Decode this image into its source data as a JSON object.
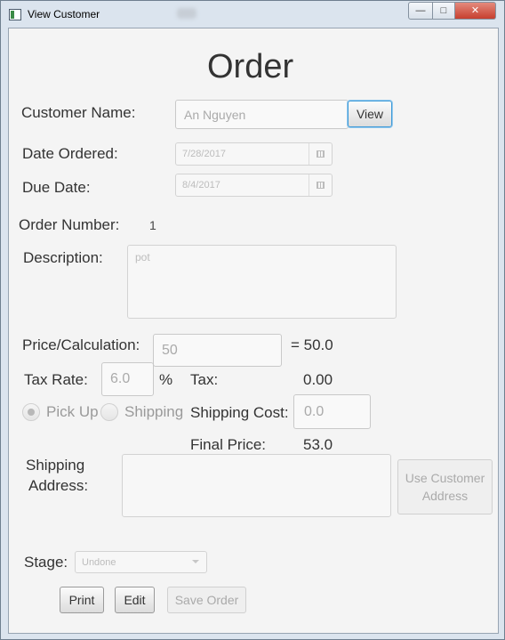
{
  "window": {
    "title": "View Customer"
  },
  "form": {
    "heading": "Order",
    "customer_name_label": "Customer Name:",
    "customer_name_value": "An Nguyen",
    "view_button": "View",
    "date_ordered_label": "Date Ordered:",
    "date_ordered_value": "7/28/2017",
    "due_date_label": "Due Date:",
    "due_date_value": "8/4/2017",
    "order_number_label": "Order Number:",
    "order_number_value": "1",
    "description_label": "Description:",
    "description_value": "pot",
    "price_label": "Price/Calculation:",
    "price_value": "50",
    "price_result": "= 50.0",
    "tax_rate_label": "Tax Rate:",
    "tax_rate_value": "6.0",
    "percent_sign": "%",
    "tax_label": "Tax:",
    "tax_value": "0.00",
    "pickup_label": "Pick Up",
    "shipping_label": "Shipping",
    "delivery_selected": "Pick Up",
    "shipping_cost_label": "Shipping Cost:",
    "shipping_cost_value": "0.0",
    "final_price_label": "Final Price:",
    "final_price_value": "53.0",
    "shipping_address_label_line1": "Shipping",
    "shipping_address_label_line2": "Address:",
    "shipping_address_value": "",
    "use_customer_address_line1": "Use Customer",
    "use_customer_address_line2": "Address",
    "stage_label": "Stage:",
    "stage_value": "Undone",
    "print_button": "Print",
    "edit_button": "Edit",
    "save_button": "Save Order"
  },
  "colors": {
    "focus_accent": "#3d9ad8",
    "close_button": "#c7402f"
  }
}
